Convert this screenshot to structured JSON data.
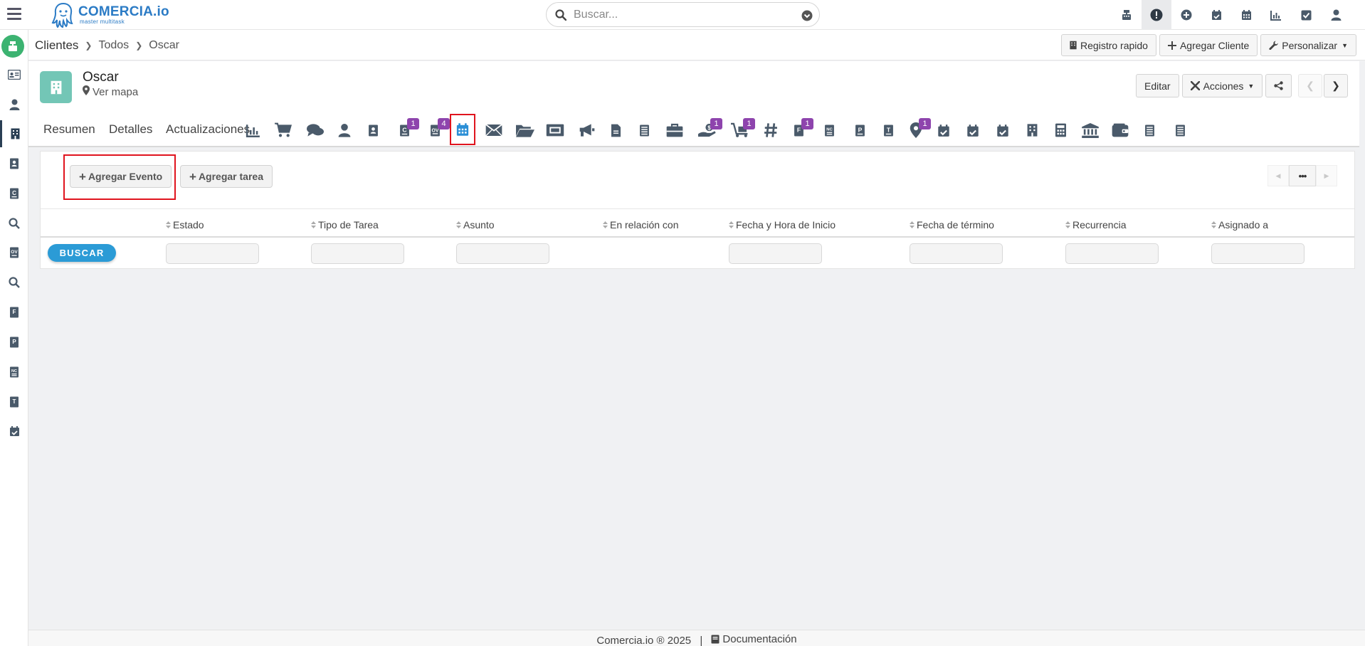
{
  "app": {
    "logo_text": "COMERCIA.io",
    "logo_subtitle": "master multitask"
  },
  "search": {
    "placeholder": "Buscar..."
  },
  "top_icons": [
    "cash-register-icon",
    "alert-icon",
    "plus-circle-icon",
    "calendar-check-icon",
    "calendar-icon",
    "bar-chart-icon",
    "checkbox-icon",
    "user-icon"
  ],
  "sidebar": {
    "items": [
      "id-card-icon",
      "user-icon",
      "building-icon",
      "contact-book-icon",
      "quote-icon",
      "search-icon",
      "sales-order-icon",
      "search-doc-icon",
      "invoice-icon",
      "purchase-icon",
      "credit-note-icon",
      "transfer-icon",
      "calendar-check-icon"
    ],
    "active_index": 2
  },
  "breadcrumb": {
    "root": "Clientes",
    "items": [
      "Todos",
      "Oscar"
    ]
  },
  "header_actions": {
    "quick_register": "Registro rapido",
    "add_client": "Agregar Cliente",
    "customize": "Personalizar"
  },
  "record": {
    "name": "Oscar",
    "map_link": "Ver mapa",
    "edit_label": "Editar",
    "actions_label": "Acciones"
  },
  "tabs": {
    "text_tabs": [
      "Resumen",
      "Detalles",
      "Actualizaciones"
    ],
    "icon_tabs": [
      {
        "icon": "bar-chart-icon",
        "badge": ""
      },
      {
        "icon": "cart-icon",
        "badge": ""
      },
      {
        "icon": "comments-icon",
        "badge": ""
      },
      {
        "icon": "user-icon",
        "badge": ""
      },
      {
        "icon": "contact-book-icon",
        "badge": ""
      },
      {
        "icon": "quote-icon",
        "badge": "1"
      },
      {
        "icon": "sales-order-icon",
        "badge": "4"
      },
      {
        "icon": "calendar-icon",
        "badge": ""
      },
      {
        "icon": "envelope-icon",
        "badge": ""
      },
      {
        "icon": "folder-open-icon",
        "badge": ""
      },
      {
        "icon": "ticket-icon",
        "badge": ""
      },
      {
        "icon": "megaphone-icon",
        "badge": ""
      },
      {
        "icon": "document-icon",
        "badge": ""
      },
      {
        "icon": "list-doc-icon",
        "badge": ""
      },
      {
        "icon": "briefcase-icon",
        "badge": ""
      },
      {
        "icon": "hand-money-icon",
        "badge": "1"
      },
      {
        "icon": "cart-flatbed-icon",
        "badge": "1"
      },
      {
        "icon": "hashtag-icon",
        "badge": ""
      },
      {
        "icon": "invoice-icon",
        "badge": "1"
      },
      {
        "icon": "credit-note-icon",
        "badge": ""
      },
      {
        "icon": "purchase-icon",
        "badge": ""
      },
      {
        "icon": "transfer-icon",
        "badge": ""
      },
      {
        "icon": "map-pin-icon",
        "badge": "1"
      },
      {
        "icon": "calendar-check-icon",
        "badge": ""
      },
      {
        "icon": "calendar-check-icon",
        "badge": ""
      },
      {
        "icon": "calendar-check-icon",
        "badge": ""
      },
      {
        "icon": "building-icon",
        "badge": ""
      },
      {
        "icon": "calculator-icon",
        "badge": ""
      },
      {
        "icon": "bank-icon",
        "badge": ""
      },
      {
        "icon": "wallet-icon",
        "badge": ""
      },
      {
        "icon": "list-doc-icon",
        "badge": ""
      },
      {
        "icon": "list-doc-icon",
        "badge": ""
      }
    ],
    "active_icon": "calendar-icon"
  },
  "panel": {
    "add_event": "Agregar Evento",
    "add_task": "Agregar tarea",
    "search_button": "BUSCAR",
    "columns": [
      "Estado",
      "Tipo de Tarea",
      "Asunto",
      "En relación con",
      "Fecha y Hora de Inicio",
      "Fecha de término",
      "Recurrencia",
      "Asignado a"
    ]
  },
  "footer": {
    "copyright": "Comercia.io ® 2025",
    "separator": "|",
    "docs": "Documentación"
  },
  "colors": {
    "brand": "#2b7bc5",
    "sidebar_home": "#3cb371",
    "badge": "#8e44ad",
    "highlight": "#e0141e",
    "search_button": "#2b9bd6",
    "icon": "#4a5a6a"
  }
}
